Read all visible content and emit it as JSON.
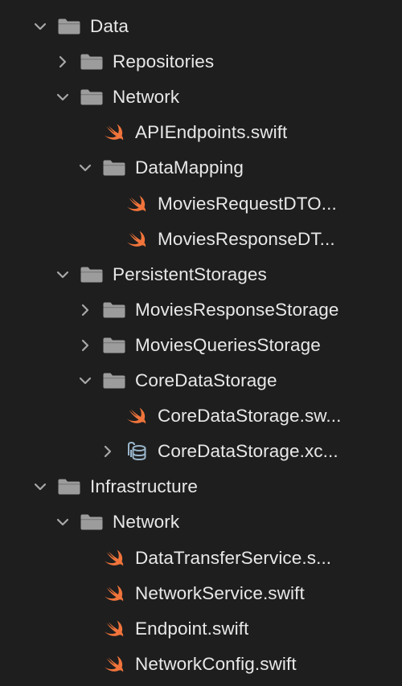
{
  "colors": {
    "background": "#1e1e1e",
    "text": "#e8e8e8",
    "chevron": "#a8a8a8",
    "folder": "#9c9c9c",
    "swift": "#f0743b",
    "coredata": "#9ab6cc"
  },
  "tree": [
    {
      "label": "Data",
      "depth": 0,
      "kind": "folder",
      "icon": "folder-icon",
      "disclosure": "expanded"
    },
    {
      "label": "Repositories",
      "depth": 1,
      "kind": "folder",
      "icon": "folder-icon",
      "disclosure": "collapsed"
    },
    {
      "label": "Network",
      "depth": 1,
      "kind": "folder",
      "icon": "folder-icon",
      "disclosure": "expanded"
    },
    {
      "label": "APIEndpoints.swift",
      "depth": 2,
      "kind": "swift",
      "icon": "swift-file-icon",
      "disclosure": "none"
    },
    {
      "label": "DataMapping",
      "depth": 2,
      "kind": "folder",
      "icon": "folder-icon",
      "disclosure": "expanded"
    },
    {
      "label": "MoviesRequestDTO...",
      "depth": 3,
      "kind": "swift",
      "icon": "swift-file-icon",
      "disclosure": "none"
    },
    {
      "label": "MoviesResponseDT...",
      "depth": 3,
      "kind": "swift",
      "icon": "swift-file-icon",
      "disclosure": "none"
    },
    {
      "label": "PersistentStorages",
      "depth": 1,
      "kind": "folder",
      "icon": "folder-icon",
      "disclosure": "expanded"
    },
    {
      "label": "MoviesResponseStorage",
      "depth": 2,
      "kind": "folder",
      "icon": "folder-icon",
      "disclosure": "collapsed"
    },
    {
      "label": "MoviesQueriesStorage",
      "depth": 2,
      "kind": "folder",
      "icon": "folder-icon",
      "disclosure": "collapsed"
    },
    {
      "label": "CoreDataStorage",
      "depth": 2,
      "kind": "folder",
      "icon": "folder-icon",
      "disclosure": "expanded"
    },
    {
      "label": "CoreDataStorage.sw...",
      "depth": 3,
      "kind": "swift",
      "icon": "swift-file-icon",
      "disclosure": "none"
    },
    {
      "label": "CoreDataStorage.xc...",
      "depth": 3,
      "kind": "coredata",
      "icon": "coredata-model-icon",
      "disclosure": "collapsed"
    },
    {
      "label": "Infrastructure",
      "depth": 0,
      "kind": "folder",
      "icon": "folder-icon",
      "disclosure": "expanded"
    },
    {
      "label": "Network",
      "depth": 1,
      "kind": "folder",
      "icon": "folder-icon",
      "disclosure": "expanded"
    },
    {
      "label": "DataTransferService.s...",
      "depth": 2,
      "kind": "swift",
      "icon": "swift-file-icon",
      "disclosure": "none"
    },
    {
      "label": "NetworkService.swift",
      "depth": 2,
      "kind": "swift",
      "icon": "swift-file-icon",
      "disclosure": "none"
    },
    {
      "label": "Endpoint.swift",
      "depth": 2,
      "kind": "swift",
      "icon": "swift-file-icon",
      "disclosure": "none"
    },
    {
      "label": "NetworkConfig.swift",
      "depth": 2,
      "kind": "swift",
      "icon": "swift-file-icon",
      "disclosure": "none"
    }
  ]
}
